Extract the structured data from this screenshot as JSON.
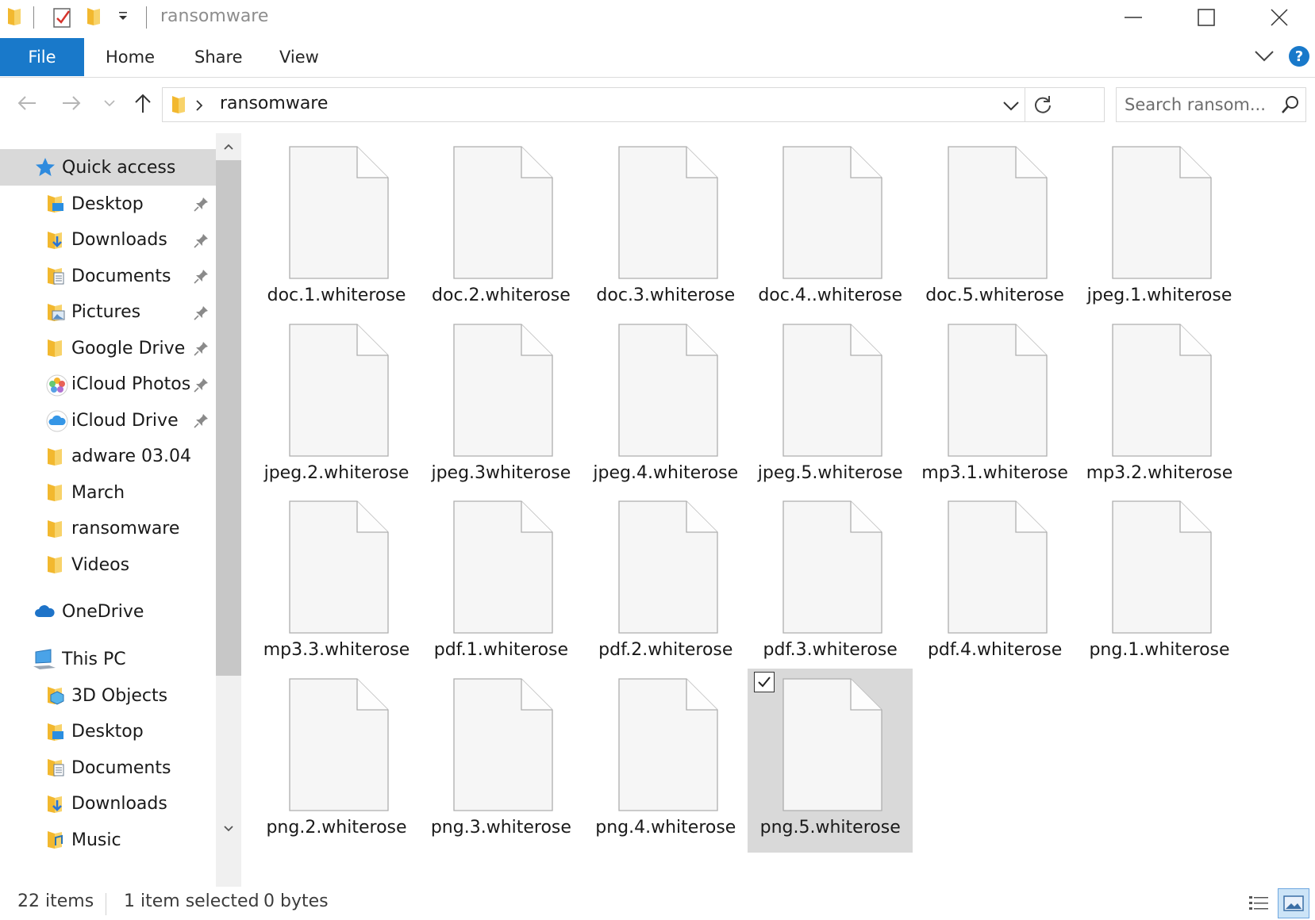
{
  "window": {
    "title": "ransomware"
  },
  "ribbon": {
    "tabs": [
      {
        "label": "File"
      },
      {
        "label": "Home"
      },
      {
        "label": "Share"
      },
      {
        "label": "View"
      }
    ],
    "help_label": "?"
  },
  "address": {
    "path_label": "ransomware",
    "search_placeholder": "Search ransom..."
  },
  "nav": {
    "quick_access": "Quick access",
    "quick_items": [
      {
        "label": "Desktop",
        "icon": "desktop-folder-icon",
        "pinned": true
      },
      {
        "label": "Downloads",
        "icon": "downloads-folder-icon",
        "pinned": true
      },
      {
        "label": "Documents",
        "icon": "documents-folder-icon",
        "pinned": true
      },
      {
        "label": "Pictures",
        "icon": "pictures-folder-icon",
        "pinned": true
      },
      {
        "label": "Google Drive",
        "icon": "folder-icon",
        "pinned": true
      },
      {
        "label": "iCloud Photos",
        "icon": "icloud-photos-icon",
        "pinned": true
      },
      {
        "label": "iCloud Drive",
        "icon": "icloud-drive-icon",
        "pinned": true
      },
      {
        "label": "adware 03.04",
        "icon": "folder-icon",
        "pinned": false
      },
      {
        "label": "March",
        "icon": "folder-icon",
        "pinned": false
      },
      {
        "label": "ransomware",
        "icon": "folder-icon",
        "pinned": false
      },
      {
        "label": "Videos",
        "icon": "folder-icon",
        "pinned": false
      }
    ],
    "onedrive": "OneDrive",
    "this_pc": "This PC",
    "pc_items": [
      {
        "label": "3D Objects",
        "icon": "3d-objects-icon"
      },
      {
        "label": "Desktop",
        "icon": "desktop-folder-icon"
      },
      {
        "label": "Documents",
        "icon": "documents-folder-icon"
      },
      {
        "label": "Downloads",
        "icon": "downloads-folder-icon"
      },
      {
        "label": "Music",
        "icon": "music-folder-icon"
      }
    ]
  },
  "files": [
    {
      "name": "doc.1.whiterose"
    },
    {
      "name": "doc.2.whiterose"
    },
    {
      "name": "doc.3.whiterose"
    },
    {
      "name": "doc.4..whiterose"
    },
    {
      "name": "doc.5.whiterose"
    },
    {
      "name": "jpeg.1.whiterose"
    },
    {
      "name": "jpeg.2.whiterose"
    },
    {
      "name": "jpeg.3whiterose"
    },
    {
      "name": "jpeg.4.whiterose"
    },
    {
      "name": "jpeg.5.whiterose"
    },
    {
      "name": "mp3.1.whiterose"
    },
    {
      "name": "mp3.2.whiterose"
    },
    {
      "name": "mp3.3.whiterose"
    },
    {
      "name": "pdf.1.whiterose"
    },
    {
      "name": "pdf.2.whiterose"
    },
    {
      "name": "pdf.3.whiterose"
    },
    {
      "name": "pdf.4.whiterose"
    },
    {
      "name": "png.1.whiterose"
    },
    {
      "name": "png.2.whiterose"
    },
    {
      "name": "png.3.whiterose"
    },
    {
      "name": "png.4.whiterose"
    },
    {
      "name": "png.5.whiterose",
      "selected": true
    }
  ],
  "status": {
    "item_count": "22 items",
    "selection": "1 item selected",
    "size": "0 bytes"
  },
  "colors": {
    "accent": "#1979ca",
    "selection_bg": "#d9d9d9",
    "folder_yellow": "#f8c848"
  }
}
